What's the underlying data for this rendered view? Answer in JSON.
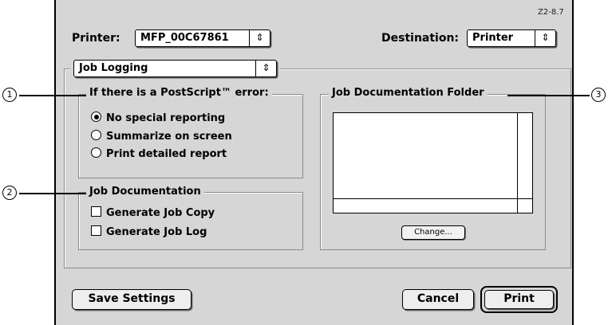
{
  "version_label": "Z2-8.7",
  "printer": {
    "label": "Printer:",
    "value": "MFP_00C67861"
  },
  "destination": {
    "label": "Destination:",
    "value": "Printer"
  },
  "panel_select": {
    "value": "Job Logging"
  },
  "postscript_error": {
    "legend": "If there is a PostScript™ error:",
    "options": [
      {
        "label": "No special reporting",
        "selected": true
      },
      {
        "label": "Summarize on screen",
        "selected": false
      },
      {
        "label": "Print detailed report",
        "selected": false
      }
    ]
  },
  "job_documentation": {
    "legend": "Job Documentation",
    "options": [
      {
        "label": "Generate Job Copy",
        "checked": false
      },
      {
        "label": "Generate Job Log",
        "checked": false
      }
    ]
  },
  "folder": {
    "legend": "Job Documentation Folder",
    "change_label": "Change..."
  },
  "buttons": {
    "save": "Save Settings",
    "cancel": "Cancel",
    "print": "Print"
  },
  "callouts": [
    "1",
    "2",
    "3"
  ],
  "icons": {
    "popup_arrow": "up-down-arrow-icon"
  }
}
